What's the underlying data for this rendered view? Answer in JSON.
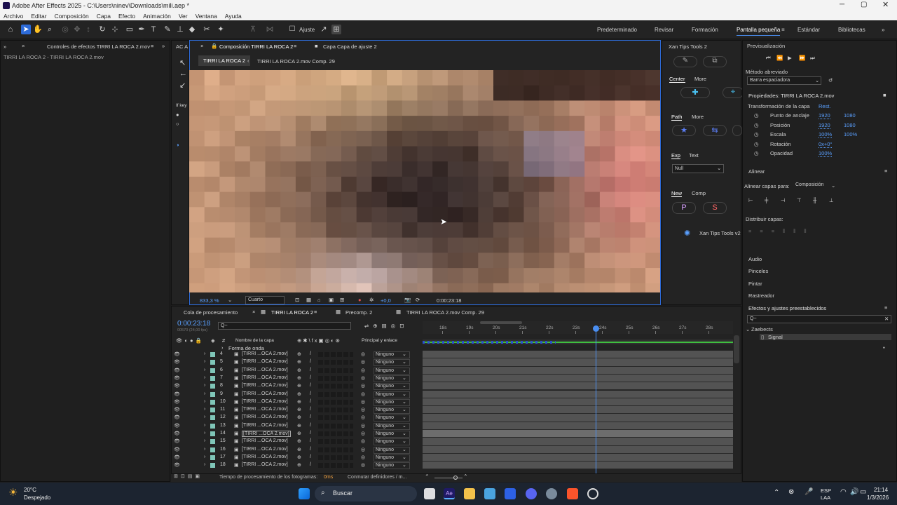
{
  "window": {
    "title": "Adobe After Effects 2025 - C:\\Users\\ninev\\Downloads\\mili.aep *"
  },
  "menu": [
    "Archivo",
    "Editar",
    "Composición",
    "Capa",
    "Efecto",
    "Animación",
    "Ver",
    "Ventana",
    "Ayuda"
  ],
  "toolbar": {
    "snap_label": "Ajuste",
    "workspaces": [
      "Predeterminado",
      "Revisar",
      "Formación",
      "Pantalla pequeña",
      "Estándar",
      "Bibliotecas"
    ]
  },
  "left_panel": {
    "tab": "Controles de efectos TIRRI LA ROCA 2.mov",
    "subtitle": "TIRRI LA ROCA 2 - TIRRI LA ROCA 2.mov",
    "mini_tab": "AC A",
    "iface_label": "If key"
  },
  "comp_viewer": {
    "tabs": [
      "Composición TIRRI LA ROCA 2",
      "Capa Capa de ajuste 2"
    ],
    "breadcrumbs": [
      "TIRRI LA ROCA 2",
      "TIRRI LA ROCA 2.mov Comp. 29"
    ],
    "zoom": "833,3 %",
    "resolution": "Cuarto",
    "exposure": "+0,0",
    "timecode": "0:00:23:18"
  },
  "xan_panel": {
    "title": "Xan Tips Tools 2",
    "tabs1": [
      "Center",
      "More"
    ],
    "tabs2": [
      "Path",
      "More"
    ],
    "tabs3": [
      "Exp",
      "Text"
    ],
    "null_select": "Null",
    "tabs4": [
      "New",
      "Comp"
    ],
    "footer": "Xan Tips Tools v2",
    "btn_p": "P",
    "btn_s": "S"
  },
  "preview": {
    "title": "Previsualización",
    "method_label": "Método abreviado",
    "method_value": "Barra espaciadora"
  },
  "properties": {
    "title": "Propiedades: TIRRI LA ROCA 2.mov",
    "group": "Transformación de la capa",
    "reset": "Rest.",
    "rows": [
      {
        "label": "Punto de anclaje",
        "v1": "1920",
        "v2": "1080"
      },
      {
        "label": "Posición",
        "v1": "1920",
        "v2": "1080"
      },
      {
        "label": "Escala",
        "v1": "100%",
        "v2": "100%"
      },
      {
        "label": "Rotación",
        "v1": "0x+0°",
        "v2": ""
      },
      {
        "label": "Opacidad",
        "v1": "100%",
        "v2": ""
      }
    ]
  },
  "align": {
    "title": "Alinear",
    "align_to_label": "Alinear capas para:",
    "align_to_value": "Composición",
    "distribute": "Distribuir capas:"
  },
  "collapsed_panels": [
    "Audio",
    "Pinceles",
    "Pintar",
    "Rastreador"
  ],
  "effects": {
    "title": "Efectos y ajustes preestablecidos",
    "search": "Q~",
    "folder": "Zaebects",
    "item": "Signal"
  },
  "timeline": {
    "tabs": [
      "Cola de procesamiento",
      "TIRRI LA ROCA 2",
      "Precomp. 2",
      "TIRRI LA ROCA 2.mov Comp. 29"
    ],
    "timecode": "0:00:23:18",
    "fps": "00570 (24,00 fps)",
    "search": "Q~",
    "col_name": "Nombre de la capa",
    "col_parent": "Principal y enlace",
    "waveform_label": "Forma de onda",
    "ticks": [
      "18s",
      "19s",
      "20s",
      "21s",
      "22s",
      "23s",
      "24s",
      "25s",
      "26s",
      "27s",
      "28s"
    ],
    "layers": [
      {
        "n": "4",
        "name": "[TIRRI ...OCA 2.mov]",
        "parent": "Ninguno"
      },
      {
        "n": "5",
        "name": "[TIRRI ...OCA 2.mov]",
        "parent": "Ninguno"
      },
      {
        "n": "6",
        "name": "[TIRRI ...OCA 2.mov]",
        "parent": "Ninguno"
      },
      {
        "n": "7",
        "name": "[TIRRI ...OCA 2.mov]",
        "parent": "Ninguno"
      },
      {
        "n": "8",
        "name": "[TIRRI ...OCA 2.mov]",
        "parent": "Ninguno"
      },
      {
        "n": "9",
        "name": "[TIRRI ...OCA 2.mov]",
        "parent": "Ninguno"
      },
      {
        "n": "10",
        "name": "[TIRRI ...OCA 2.mov]",
        "parent": "Ninguno"
      },
      {
        "n": "11",
        "name": "[TIRRI ...OCA 2.mov]",
        "parent": "Ninguno"
      },
      {
        "n": "12",
        "name": "[TIRRI ...OCA 2.mov]",
        "parent": "Ninguno"
      },
      {
        "n": "13",
        "name": "[TIRRI ...OCA 2.mov]",
        "parent": "Ninguno"
      },
      {
        "n": "14",
        "name": "[TIRRI ...OCA 2.mov]",
        "parent": "Ninguno"
      },
      {
        "n": "15",
        "name": "[TIRRI ...OCA 2.mov]",
        "parent": "Ninguno"
      },
      {
        "n": "16",
        "name": "[TIRRI ...OCA 2.mov]",
        "parent": "Ninguno"
      },
      {
        "n": "17",
        "name": "[TIRRI ...OCA 2.mov]",
        "parent": "Ninguno"
      },
      {
        "n": "18",
        "name": "[TIRRI ...OCA 2.mov]",
        "parent": "Ninguno"
      }
    ],
    "status_render": "Tiempo de procesamiento de los fotogramas:",
    "status_ms": "0ms",
    "status_switch": "Conmutar definidores / m..."
  },
  "taskbar": {
    "temp": "20°C",
    "weather": "Despejado",
    "search": "Buscar",
    "lang1": "ESP",
    "lang2": "LAA",
    "time": "21:14",
    "date": "1/3/2026"
  }
}
